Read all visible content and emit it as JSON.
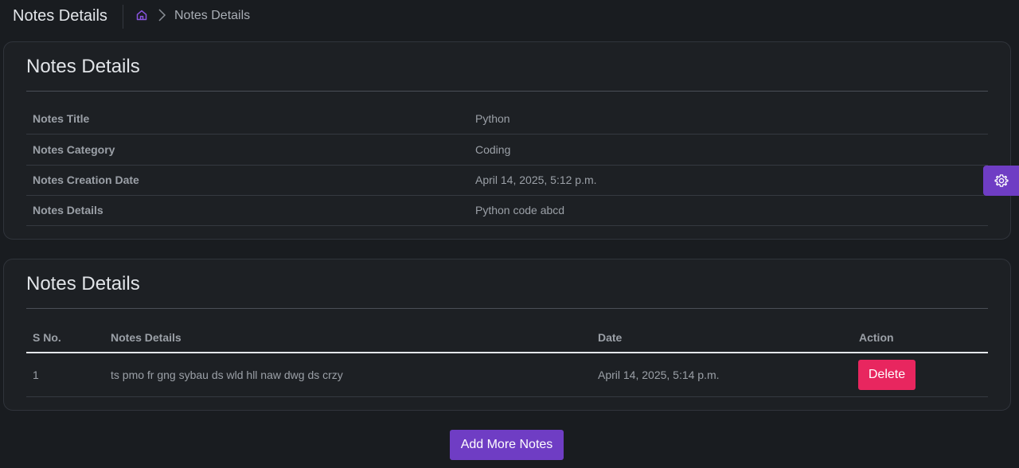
{
  "header": {
    "title": "Notes Details",
    "breadcrumb": {
      "current": "Notes Details"
    },
    "icons": {
      "home": "home-icon",
      "separator": "chevron-right-icon"
    }
  },
  "details_card": {
    "title": "Notes Details",
    "rows": [
      {
        "label": "Notes Title",
        "value": "Python"
      },
      {
        "label": "Notes Category",
        "value": "Coding"
      },
      {
        "label": "Notes Creation Date",
        "value": "April 14, 2025, 5:12 p.m."
      },
      {
        "label": "Notes Details",
        "value": "Python code abcd"
      }
    ]
  },
  "notes_table": {
    "title": "Notes Details",
    "columns": [
      "S No.",
      "Notes Details",
      "Date",
      "Action"
    ],
    "rows": [
      {
        "sno": "1",
        "details": "ts pmo fr gng sybau ds wld hll naw dwg ds crzy",
        "date": "April 14, 2025, 5:14 p.m.",
        "action_label": "Delete"
      }
    ]
  },
  "add_button_label": "Add More Notes",
  "settings": {
    "icon": "gear-icon"
  },
  "colors": {
    "background": "#191c20",
    "card": "#1d2024",
    "accent": "#6f3dc4",
    "danger": "#e8265f",
    "text": "#9ba0a7"
  }
}
